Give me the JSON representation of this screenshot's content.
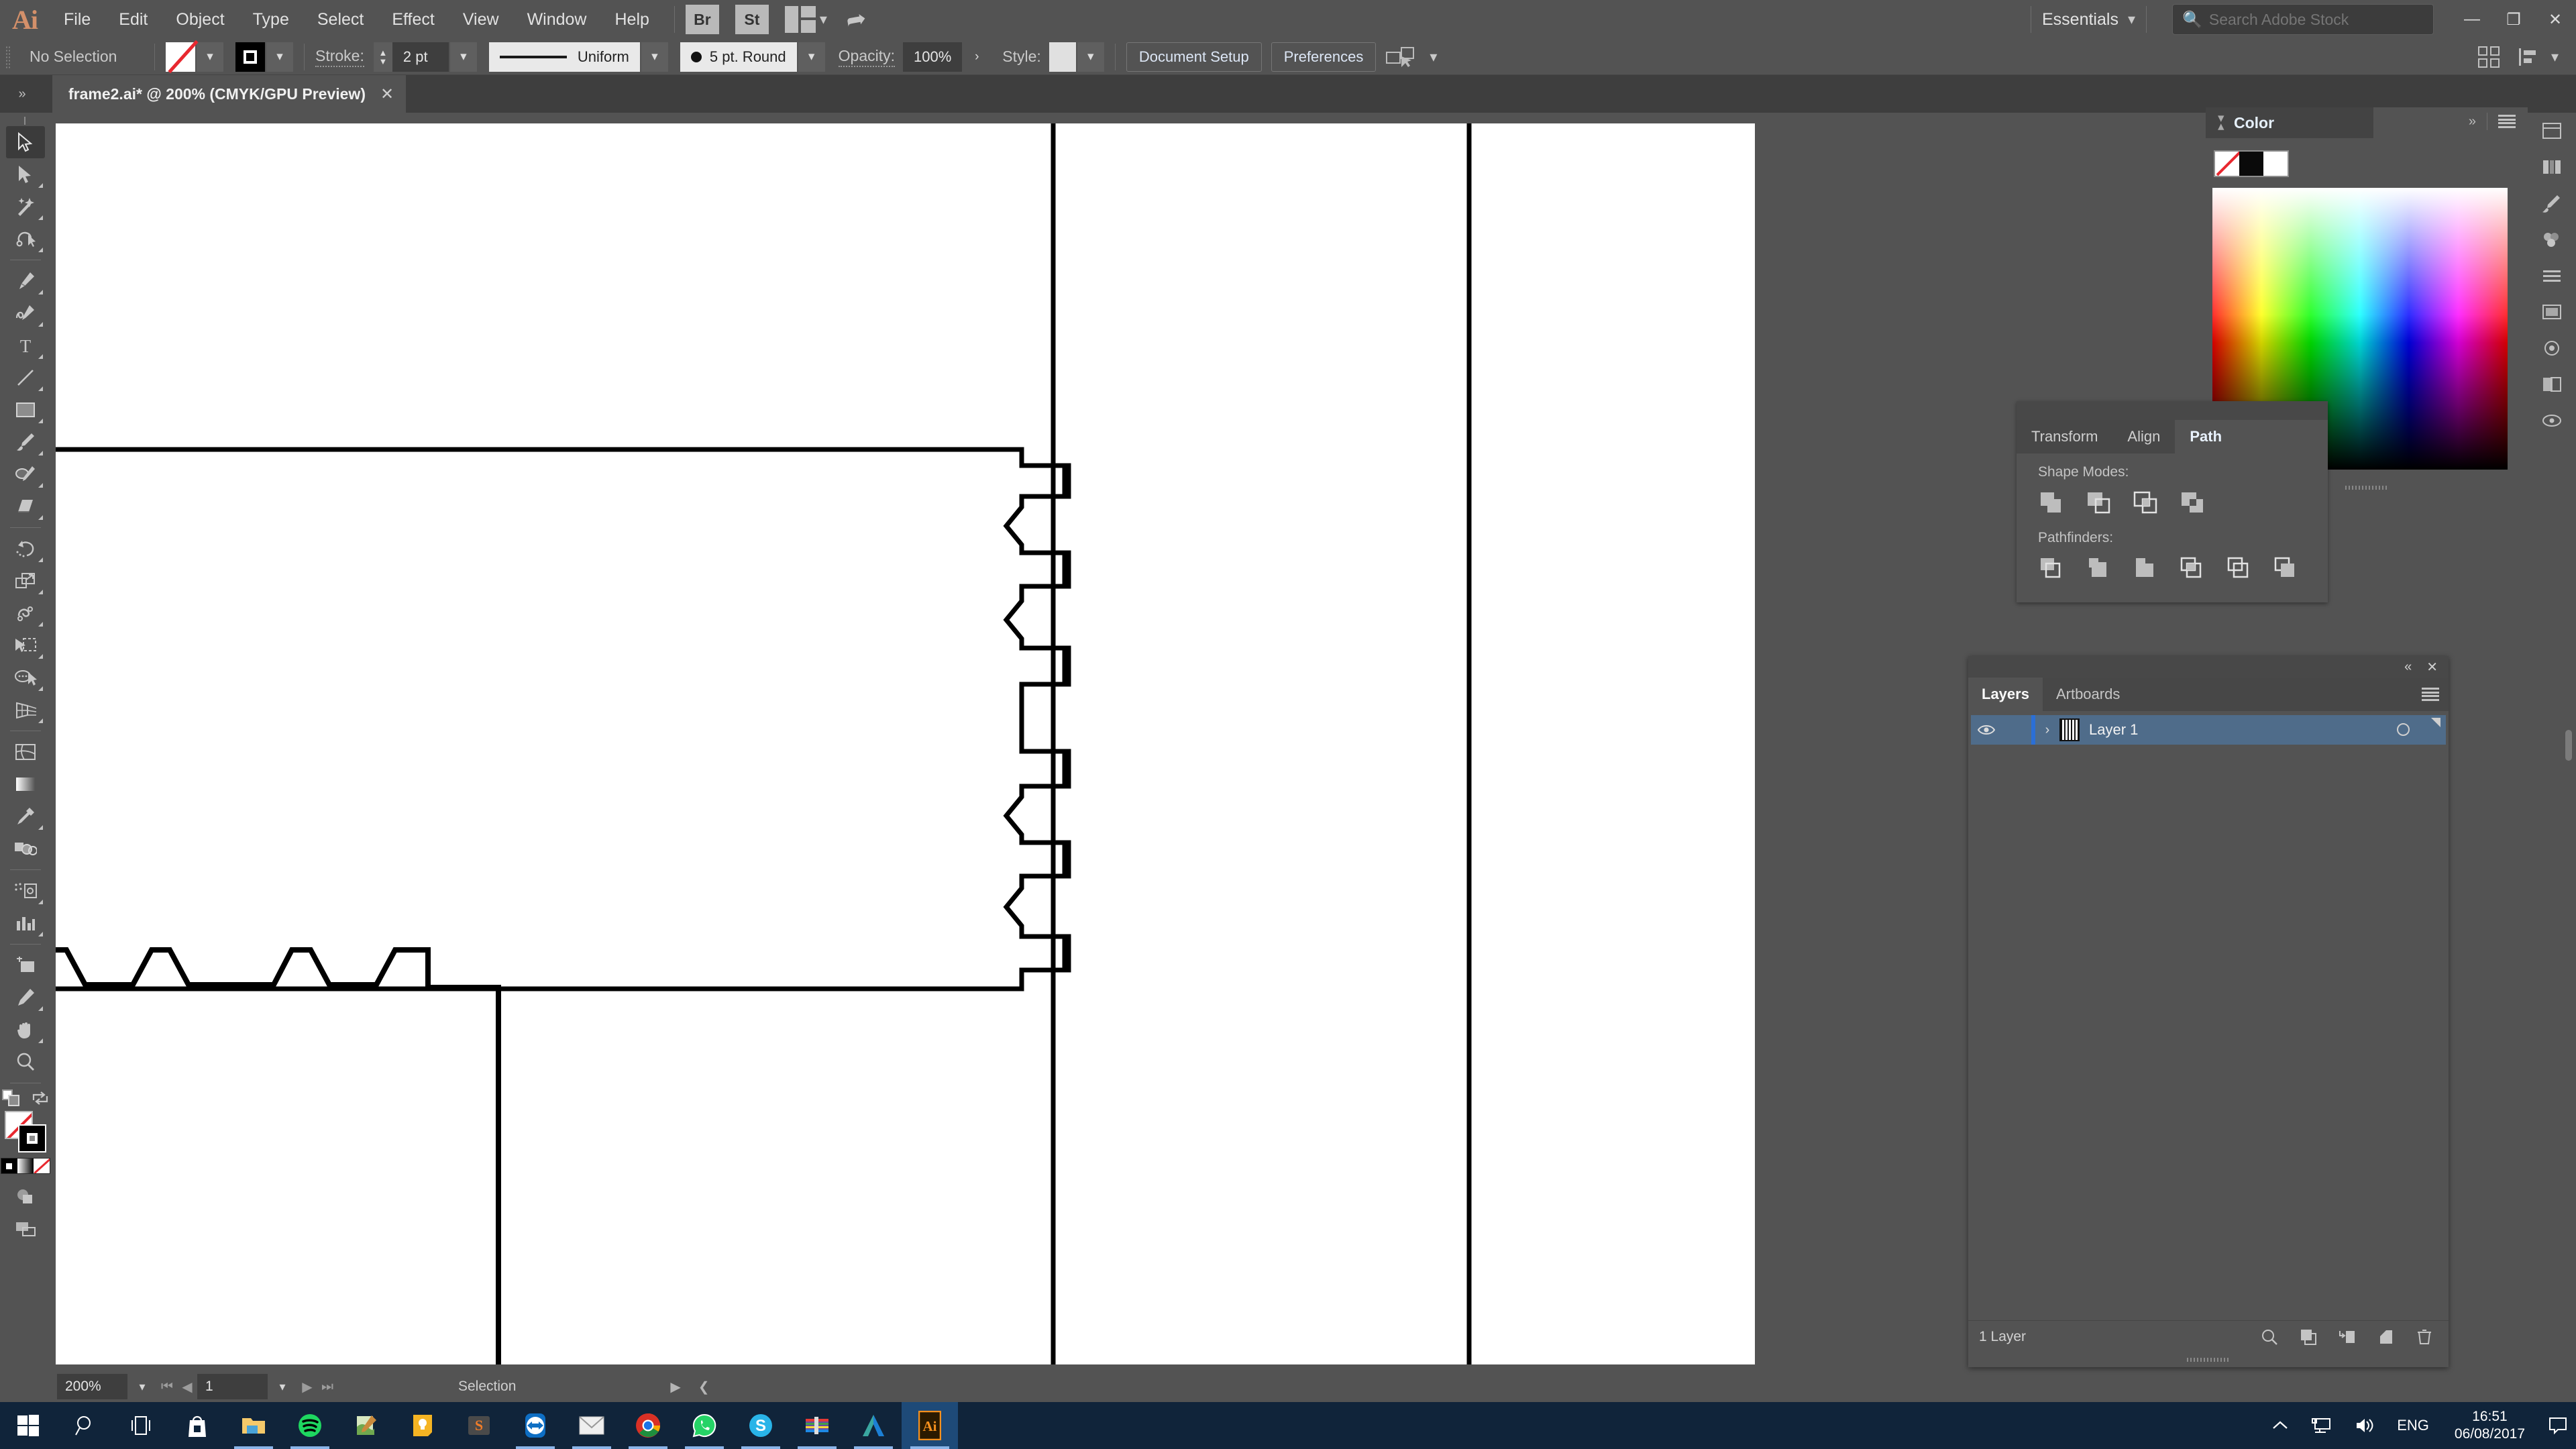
{
  "app": {
    "name": "Adobe Illustrator",
    "logo_text": "Ai"
  },
  "menubar": {
    "items": [
      {
        "label": "File"
      },
      {
        "label": "Edit"
      },
      {
        "label": "Object"
      },
      {
        "label": "Type"
      },
      {
        "label": "Select"
      },
      {
        "label": "Effect"
      },
      {
        "label": "View"
      },
      {
        "label": "Window"
      },
      {
        "label": "Help"
      }
    ],
    "bridge_label": "Br",
    "stock_label": "St",
    "workspace": "Essentials",
    "search_placeholder": "Search Adobe Stock",
    "search_value": "",
    "window_buttons": {
      "minimize": "—",
      "restore": "❐",
      "close": "✕"
    }
  },
  "controlbar": {
    "selection_state": "No Selection",
    "fill_swatch": "none-swatch",
    "stroke_swatch": "black-stroke-swatch",
    "stroke_label": "Stroke:",
    "stroke_weight": "2 pt",
    "stroke_profile": "Uniform",
    "brush_definition": "5 pt. Round",
    "opacity_label": "Opacity:",
    "opacity_value": "100%",
    "style_label": "Style:",
    "document_setup": "Document Setup",
    "preferences": "Preferences"
  },
  "tabbar": {
    "dock_toggle": "»",
    "document_title": "frame2.ai* @ 200% (CMYK/GPU Preview)",
    "close": "✕"
  },
  "toolbar": {
    "tools": [
      {
        "name": "selection-tool",
        "active": true
      },
      {
        "name": "direct-selection-tool",
        "active": false
      },
      {
        "name": "magic-wand-tool",
        "active": false
      },
      {
        "name": "lasso-tool",
        "active": false
      },
      {
        "name": "pen-tool",
        "active": false
      },
      {
        "name": "curvature-tool",
        "active": false
      },
      {
        "name": "type-tool",
        "active": false
      },
      {
        "name": "line-segment-tool",
        "active": false
      },
      {
        "name": "rectangle-tool",
        "active": false
      },
      {
        "name": "paintbrush-tool",
        "active": false
      },
      {
        "name": "shaper-tool",
        "active": false
      },
      {
        "name": "eraser-tool",
        "active": false
      },
      {
        "name": "rotate-tool",
        "active": false
      },
      {
        "name": "scale-tool",
        "active": false
      },
      {
        "name": "width-tool",
        "active": false
      },
      {
        "name": "free-transform-tool",
        "active": false
      },
      {
        "name": "shape-builder-tool",
        "active": false
      },
      {
        "name": "perspective-grid-tool",
        "active": false
      },
      {
        "name": "mesh-tool",
        "active": false
      },
      {
        "name": "gradient-tool",
        "active": false
      },
      {
        "name": "eyedropper-tool",
        "active": false
      },
      {
        "name": "blend-tool",
        "active": false
      },
      {
        "name": "symbol-sprayer-tool",
        "active": false
      },
      {
        "name": "column-graph-tool",
        "active": false
      },
      {
        "name": "artboard-tool",
        "active": false
      },
      {
        "name": "slice-tool",
        "active": false
      },
      {
        "name": "hand-tool",
        "active": false
      },
      {
        "name": "zoom-tool",
        "active": false
      }
    ]
  },
  "color_panel": {
    "title": "Color",
    "collapse_icon": "»",
    "menu_icon": "panel-menu-icon",
    "swatches": [
      "none",
      "#0a0a0a",
      "#ffffff"
    ]
  },
  "pathfinder_panel": {
    "tabs": [
      {
        "label": "Transform",
        "active": false
      },
      {
        "label": "Align",
        "active": false
      },
      {
        "label": "Path",
        "active": true
      }
    ],
    "shape_modes_label": "Shape Modes:",
    "shape_modes": [
      "unite",
      "minus-front",
      "intersect",
      "exclude"
    ],
    "pathfinders_label": "Pathfinders:",
    "pathfinders": [
      "divide",
      "trim",
      "merge",
      "crop",
      "outline",
      "minus-back"
    ]
  },
  "layers_panel": {
    "collapse_icon": "«",
    "close_icon": "✕",
    "tabs": [
      {
        "label": "Layers",
        "active": true
      },
      {
        "label": "Artboards",
        "active": false
      }
    ],
    "menu_icon": "panel-menu-icon",
    "rows": [
      {
        "name": "Layer 1",
        "visible": true,
        "expand": "›",
        "selected": true
      }
    ],
    "footer_count": "1 Layer",
    "footer_icons": [
      "locate-object-icon",
      "make-clipping-mask-icon",
      "create-new-sublayer-icon",
      "create-new-layer-icon",
      "delete-selection-icon"
    ]
  },
  "statusbar": {
    "zoom": "200%",
    "artboard_number": "1",
    "status_text": "Selection",
    "nav_first": "⏮",
    "nav_prev": "◀",
    "nav_next": "▶",
    "nav_last": "⏭"
  },
  "taskbar": {
    "start": "windows-start-icon",
    "apps": [
      {
        "name": "search-icon",
        "running": false
      },
      {
        "name": "task-view-icon",
        "running": false
      },
      {
        "name": "microsoft-store-icon",
        "running": false
      },
      {
        "name": "file-explorer-icon",
        "running": true
      },
      {
        "name": "spotify-icon",
        "running": true
      },
      {
        "name": "notepad-icon",
        "running": false
      },
      {
        "name": "sticky-notes-icon",
        "running": false
      },
      {
        "name": "sublime-text-icon",
        "running": false
      },
      {
        "name": "teamviewer-icon",
        "running": true
      },
      {
        "name": "mail-icon",
        "running": true
      },
      {
        "name": "google-chrome-icon",
        "running": true
      },
      {
        "name": "whatsapp-icon",
        "running": true
      },
      {
        "name": "skype-icon",
        "running": true
      },
      {
        "name": "winrar-icon",
        "running": true
      },
      {
        "name": "autodesk-icon",
        "running": true
      },
      {
        "name": "adobe-illustrator-icon",
        "running": true,
        "focused": true
      }
    ],
    "tray": {
      "chevron": "show-hidden-icons",
      "network": "network-icon",
      "volume": "volume-icon",
      "language": "ENG",
      "time": "16:51",
      "date": "06/08/2017",
      "notifications": "action-center-icon"
    }
  },
  "artwork": {
    "description": "Vector line drawing of interlocking frame panels with finger-joint tabs",
    "stroke_color": "#000000",
    "fill_color": "#ffffff"
  }
}
